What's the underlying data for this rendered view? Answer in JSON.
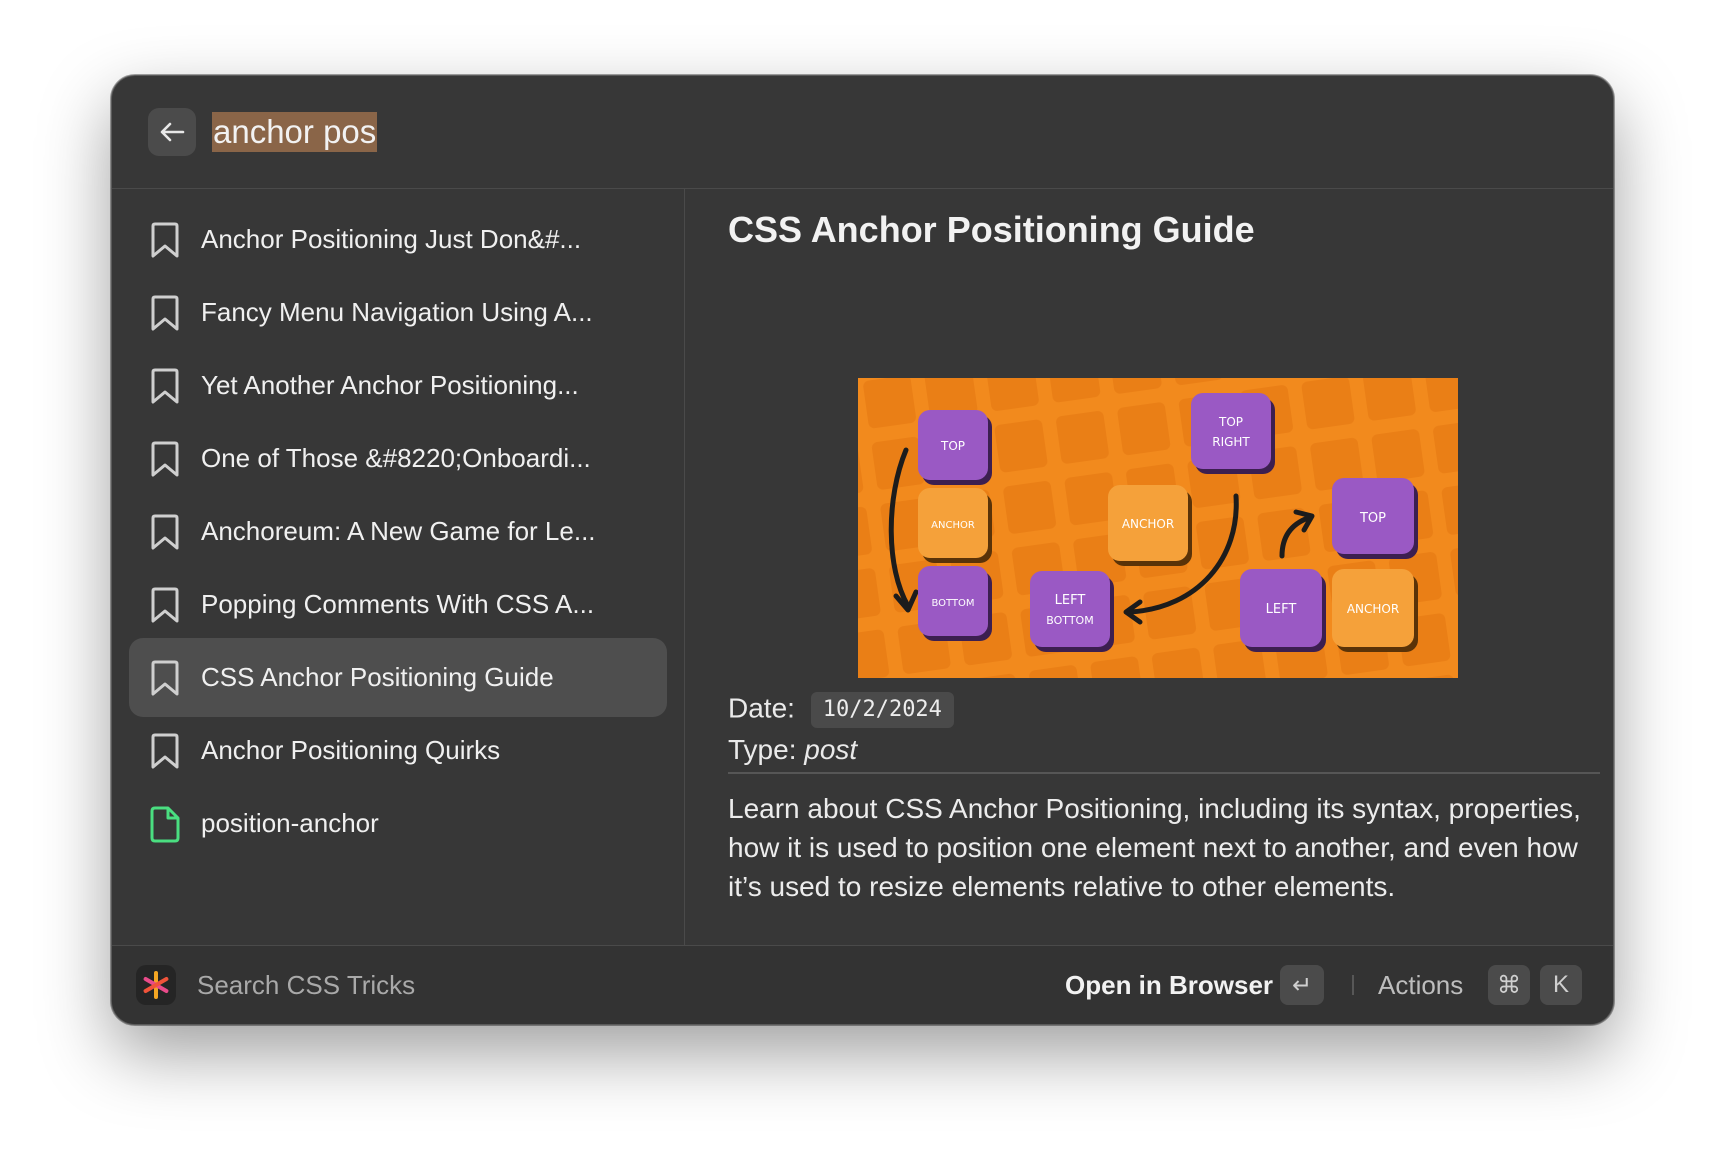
{
  "search": {
    "query": "anchor pos"
  },
  "results": [
    {
      "label": "Anchor Positioning Just Don&#...",
      "icon": "bookmark-icon"
    },
    {
      "label": "Fancy Menu Navigation Using A...",
      "icon": "bookmark-icon"
    },
    {
      "label": "Yet Another Anchor Positioning...",
      "icon": "bookmark-icon"
    },
    {
      "label": "One of Those &#8220;Onboardi...",
      "icon": "bookmark-icon"
    },
    {
      "label": "Anchoreum: A New Game for Le...",
      "icon": "bookmark-icon"
    },
    {
      "label": "Popping Comments With CSS A...",
      "icon": "bookmark-icon"
    },
    {
      "label": "CSS Anchor Positioning Guide",
      "icon": "bookmark-icon",
      "selected": true
    },
    {
      "label": "Anchor Positioning Quirks",
      "icon": "bookmark-icon"
    },
    {
      "label": "position-anchor",
      "icon": "document-icon"
    }
  ],
  "detail": {
    "title": "CSS Anchor Positioning Guide",
    "image_tiles": {
      "top_left": "TOP",
      "anchor_left": "ANCHOR",
      "bottom_left": "BOTTOM",
      "left_bottom_1": "LEFT",
      "left_bottom_2": "BOTTOM",
      "anchor_middle": "ANCHOR",
      "top_right_1": "TOP",
      "top_right_2": "RIGHT",
      "top_far": "TOP",
      "left_far": "LEFT",
      "anchor_far": "ANCHOR"
    },
    "date_label": "Date:",
    "date_value": "10/2/2024",
    "type_label": "Type:",
    "type_value": "post",
    "description": "Learn about CSS Anchor Positioning, including its syntax, properties, how it is used to position one element next to another, and even how it’s used to resize elements relative to other elements."
  },
  "footer": {
    "app_title": "Search CSS Tricks",
    "primary_action": "Open in Browser",
    "primary_shortcut": "↵",
    "actions_label": "Actions",
    "actions_shortcut_mod": "⌘",
    "actions_shortcut_key": "K"
  },
  "colors": {
    "window_bg": "#373737",
    "selection_bg": "#4e4e4e",
    "search_highlight": "#8a6548",
    "hero_orange": "#f28a1d",
    "tile_purple": "#9a59c4",
    "tile_orange": "#f5a13a",
    "document_icon_green": "#4ade80"
  }
}
